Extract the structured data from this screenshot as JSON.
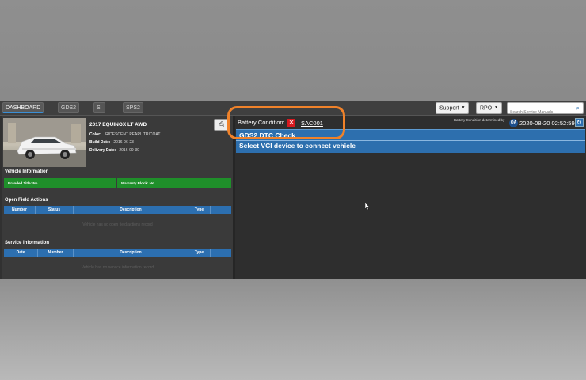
{
  "tabs": [
    {
      "label": "DASHBOARD",
      "active": true
    },
    {
      "label": "GDS2",
      "active": false
    },
    {
      "label": "SI",
      "active": false
    },
    {
      "label": "SPS2",
      "active": false
    }
  ],
  "toolbar": {
    "support_label": "Support",
    "rpo_label": "RPO",
    "search_placeholder": "Search Service Manuals"
  },
  "vehicle": {
    "title": "2017 EQUINOX LT AWD",
    "color_label": "Color:",
    "color_value": "IRIDESCENT PEARL TRICOAT",
    "build_label": "Build Date:",
    "build_value": "2016-06-23",
    "delivery_label": "Delivery Date:",
    "delivery_value": "2016-09-30"
  },
  "vehicle_info": {
    "heading": "Vehicle Information",
    "branded_title": "Branded Title: No",
    "warranty_block": "Warranty Block: No"
  },
  "field_actions": {
    "heading": "Open Field Actions",
    "columns": [
      "Number",
      "Status",
      "Description",
      "Type"
    ],
    "empty_text": "Vehicle has no open field actions record"
  },
  "service_info": {
    "heading": "Service Information",
    "columns": [
      "Date",
      "Number",
      "Description",
      "Type"
    ],
    "empty_text": "Vehicle has no service information record"
  },
  "battery": {
    "label": "Battery Condition:",
    "code": "SAC001",
    "determined_by": "Battery Condition determined by",
    "oa_badge": "OA",
    "timestamp": "2020-08-20 02:52:59"
  },
  "dtc": {
    "title": "GDS2 DTC Check",
    "message": "Select VCI device to connect vehicle"
  },
  "colors": {
    "accent": "#2d6fae",
    "highlight": "#f0822a",
    "status_green": "#1f8f2a",
    "error_red": "#d71920"
  },
  "icons": {
    "print": "printer-icon",
    "search": "search-icon",
    "refresh": "refresh-icon",
    "battery_status": "close-icon"
  }
}
